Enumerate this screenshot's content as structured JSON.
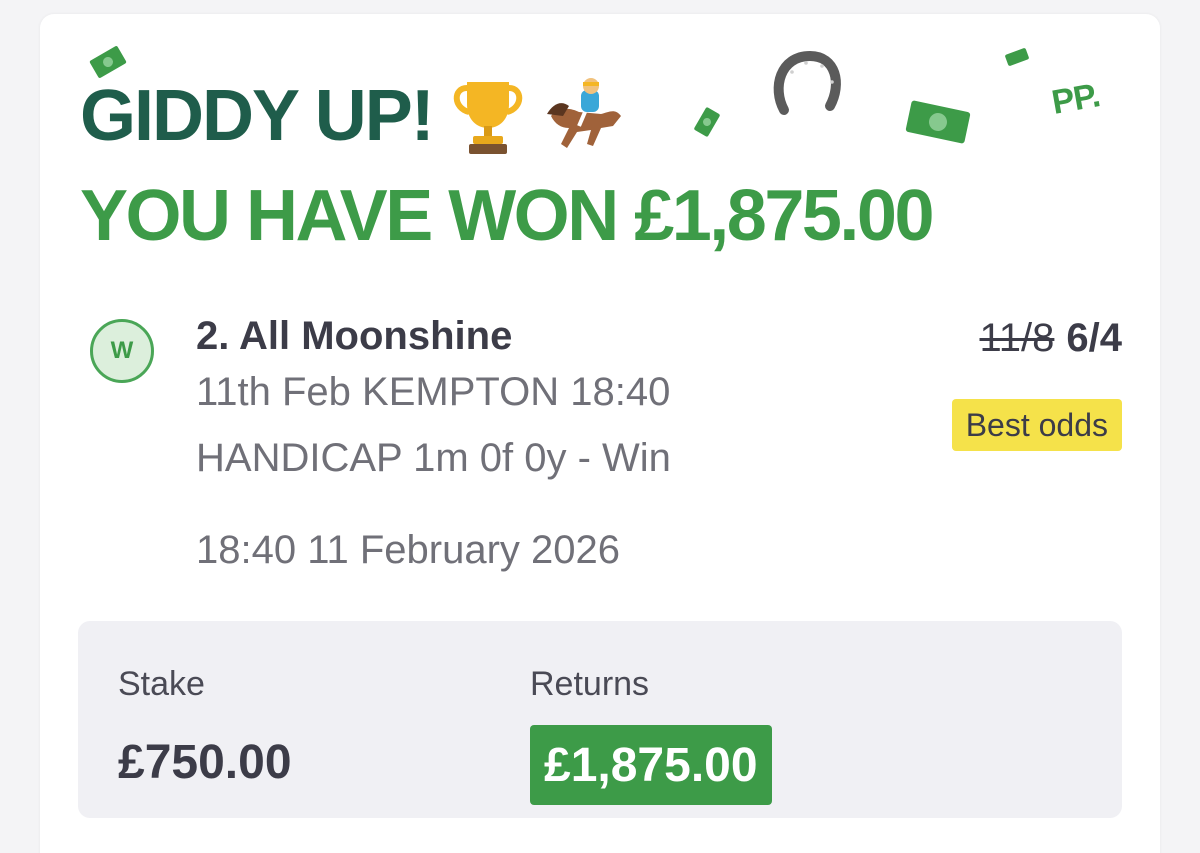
{
  "banner": {
    "headline_line1": "GIDDY UP!",
    "headline_line2": "YOU HAVE WON £1,875.00",
    "emoji_trophy": "🏆",
    "emoji_horse_racing": "🏇",
    "logo": "PP."
  },
  "bet": {
    "result_badge": "W",
    "selection": "2. All Moonshine",
    "event_line1": "11th Feb KEMPTON 18:40",
    "event_line2": "HANDICAP 1m 0f 0y - Win",
    "event_datetime": "18:40 11 February 2026",
    "odds_original": "11/8",
    "odds_current": "6/4",
    "best_odds_label": "Best odds"
  },
  "summary": {
    "stake_label": "Stake",
    "stake_value": "£750.00",
    "returns_label": "Returns",
    "returns_value": "£1,875.00"
  },
  "colors": {
    "headline_dark_green": "#1f5d4b",
    "headline_green": "#3d9b48",
    "best_odds_yellow": "#f5e24a",
    "panel_grey": "#f0f0f4"
  },
  "icons": [
    "banknote-icon",
    "horseshoe-icon",
    "trophy-icon",
    "horse-racing-icon",
    "win-badge-icon"
  ]
}
